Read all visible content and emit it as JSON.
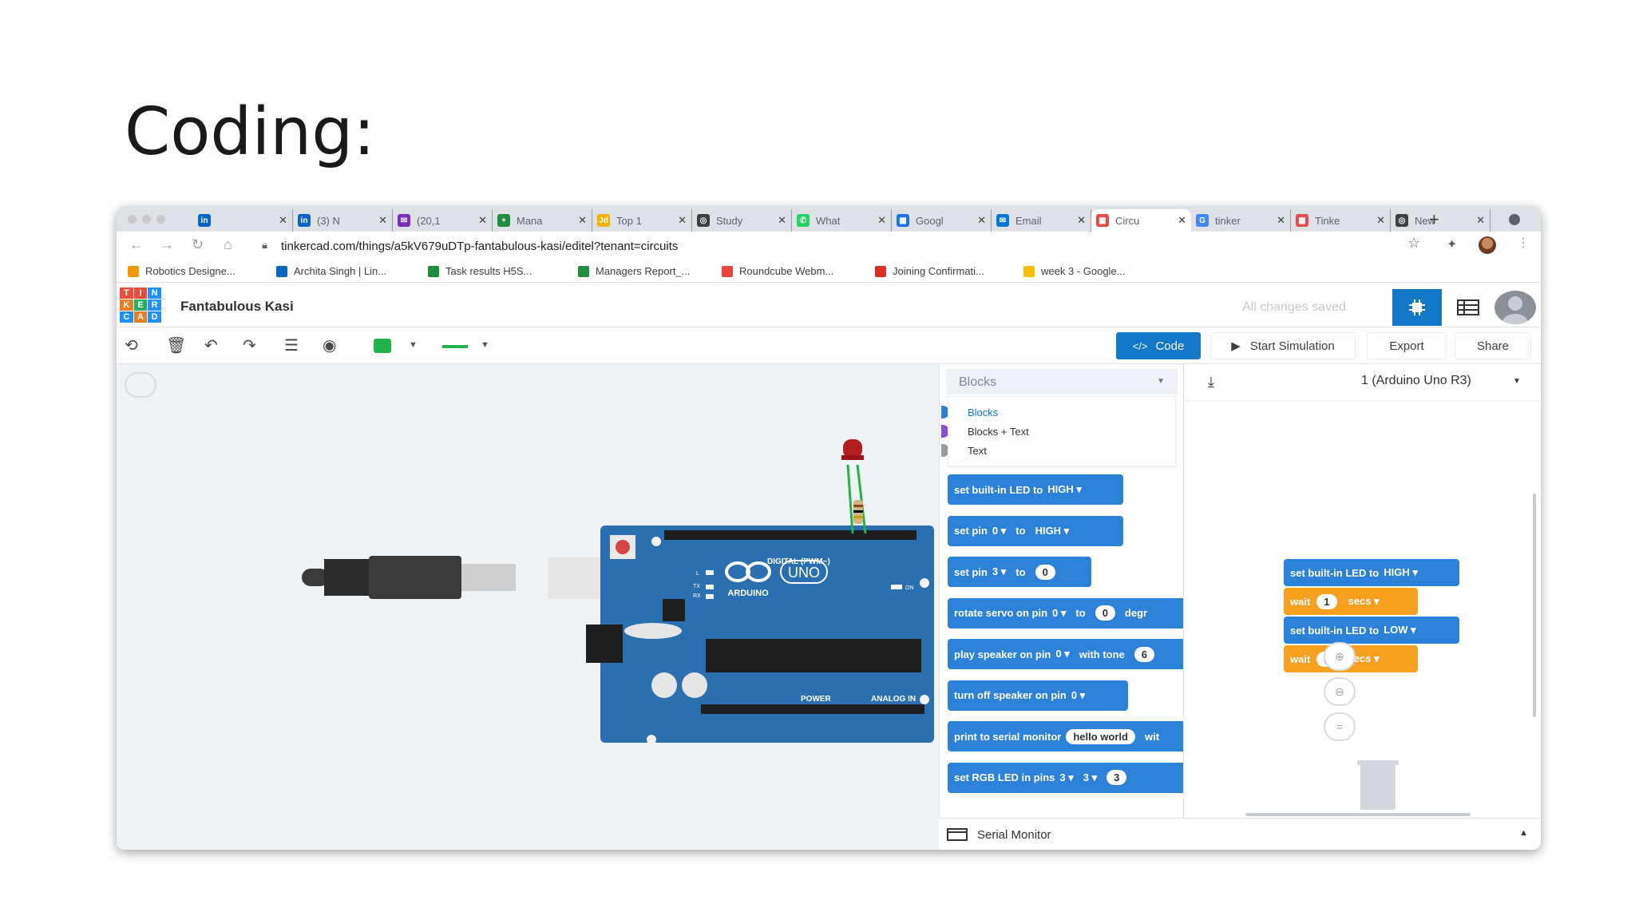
{
  "slide": {
    "title": "Coding:"
  },
  "browser": {
    "tabs": [
      {
        "label": "",
        "color": "#0a66c2",
        "glyph": "in"
      },
      {
        "label": "(3) N",
        "color": "#0a66c2",
        "glyph": "in"
      },
      {
        "label": "(20,1",
        "color": "#7b2fbf",
        "glyph": "✉"
      },
      {
        "label": "Mana",
        "color": "#1e8e3e",
        "glyph": "+"
      },
      {
        "label": "Top 1",
        "color": "#f0b400",
        "glyph": "Jd"
      },
      {
        "label": "Study",
        "color": "#3c4043",
        "glyph": "◎"
      },
      {
        "label": "What",
        "color": "#25d366",
        "glyph": "✆"
      },
      {
        "label": "Googl",
        "color": "#1a73e8",
        "glyph": "▦"
      },
      {
        "label": "Email",
        "color": "#0078d4",
        "glyph": "✉"
      },
      {
        "label": "Circu",
        "color": "#e54b4b",
        "glyph": "▦"
      },
      {
        "label": "tinker",
        "color": "#4285f4",
        "glyph": "G"
      },
      {
        "label": "Tinke",
        "color": "#e54b4b",
        "glyph": "▦"
      },
      {
        "label": "New",
        "color": "#3c4043",
        "glyph": "◎"
      }
    ],
    "new_tab": "+",
    "url": "tinkercad.com/things/a5kV679uDTp-fantabulous-kasi/editel?tenant=circuits",
    "bookmarks": [
      {
        "label": "Robotics Designe...",
        "color": "#f29900"
      },
      {
        "label": "Archita Singh | Lin...",
        "color": "#0a66c2"
      },
      {
        "label": "Task results H5S...",
        "color": "#1e8e3e"
      },
      {
        "label": "Managers Report_...",
        "color": "#1e8e3e"
      },
      {
        "label": "Roundcube Webm...",
        "color": "#e8453c"
      },
      {
        "label": "Joining Confirmati...",
        "color": "#d93025"
      },
      {
        "label": "week 3 - Google...",
        "color": "#fbbc04"
      }
    ]
  },
  "tinkercad": {
    "logo_letters": [
      "T",
      "I",
      "N",
      "K",
      "E",
      "R",
      "C",
      "A",
      "D"
    ],
    "project_name": "Fantabulous Kasi",
    "save_status": "All changes saved",
    "toolbar": {
      "code_label": "Code",
      "start_sim_label": "Start Simulation",
      "export_label": "Export",
      "share_label": "Share"
    },
    "colors": {
      "accent": "#1478c8",
      "wire": "#22b14c",
      "block_blue": "#2c82d8",
      "block_orange": "#f7a020"
    }
  },
  "blocks_panel": {
    "mode_selected": "Blocks",
    "mode_options": [
      "Blocks",
      "Blocks + Text",
      "Text"
    ],
    "blocks": [
      {
        "parts": [
          "set built-in LED to",
          "HIGH ▾"
        ]
      },
      {
        "parts": [
          "set pin",
          "0 ▾",
          "to",
          "HIGH ▾"
        ]
      },
      {
        "parts": [
          "set pin",
          "3 ▾",
          "to",
          "0"
        ]
      },
      {
        "parts": [
          "rotate servo on pin",
          "0 ▾",
          "to",
          "0",
          "degr"
        ]
      },
      {
        "parts": [
          "play speaker on pin",
          "0 ▾",
          "with tone",
          "6"
        ]
      },
      {
        "parts": [
          "turn off speaker on pin",
          "0 ▾"
        ]
      },
      {
        "parts": [
          "print to serial monitor",
          "hello world",
          "wit"
        ]
      },
      {
        "parts": [
          "set RGB LED in pins",
          "3 ▾",
          "3 ▾",
          "3"
        ]
      }
    ]
  },
  "script": {
    "device": "1 (Arduino Uno R3)",
    "blocks": [
      {
        "kind": "blue",
        "label": "set built-in LED to",
        "value": "HIGH ▾"
      },
      {
        "kind": "orange",
        "label": "wait",
        "pill": "1",
        "unit": "secs ▾"
      },
      {
        "kind": "blue",
        "label": "set built-in LED to",
        "value": "LOW ▾"
      },
      {
        "kind": "orange",
        "label": "wait",
        "pill": "1",
        "unit": "secs ▾"
      }
    ]
  },
  "serial_monitor": {
    "label": "Serial Monitor"
  },
  "board": {
    "brand": "ARDUINO",
    "model": "UNO",
    "digital_label": "DIGITAL (PWM~)",
    "power_label": "POWER",
    "analog_label": "ANALOG IN",
    "on_label": "ON",
    "tx_label": "TX",
    "rx_label": "RX",
    "l_label": "L"
  }
}
